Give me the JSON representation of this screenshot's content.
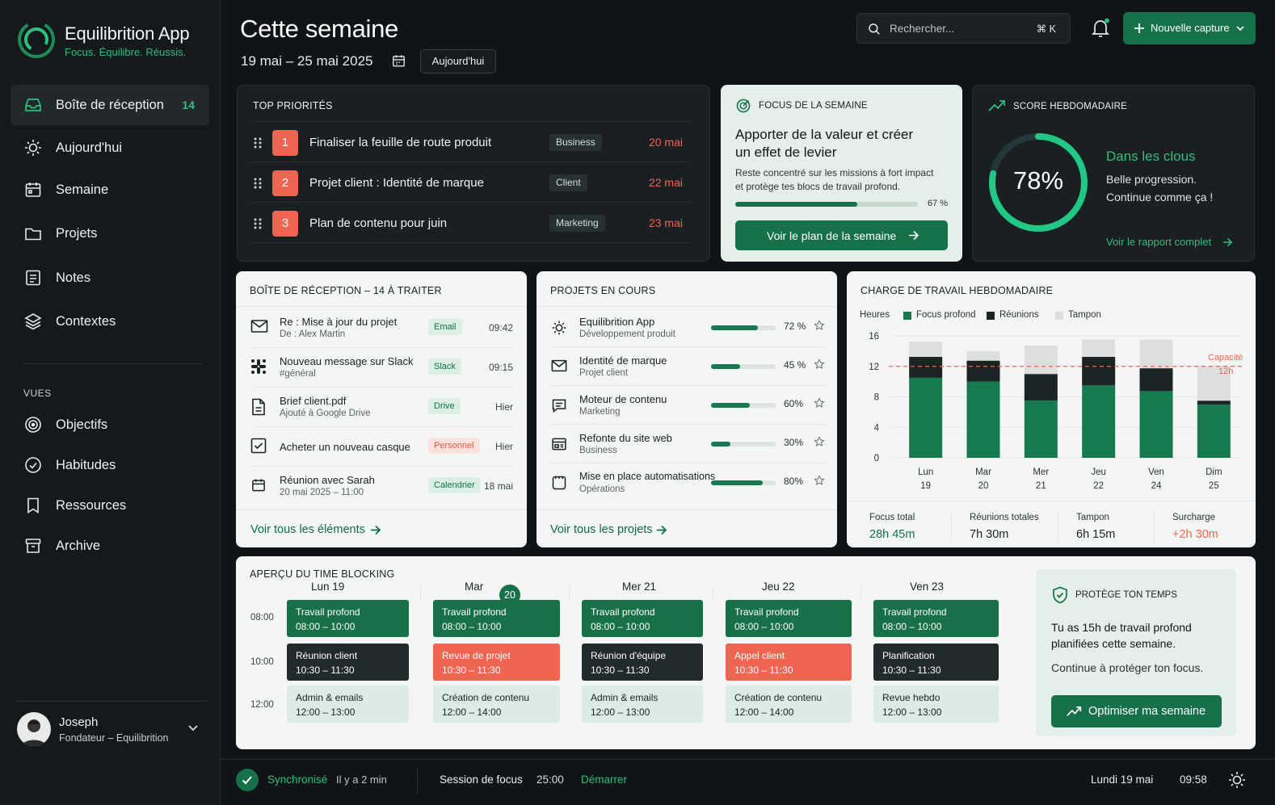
{
  "app": {
    "name": "Equilibrition App",
    "tagline": "Focus. Équilibre. Réussis."
  },
  "sidebar": {
    "items": [
      {
        "label": "Boîte de réception",
        "count": "14",
        "icon": "inbox-icon",
        "active": true
      },
      {
        "label": "Aujourd'hui",
        "icon": "sun-icon"
      },
      {
        "label": "Semaine",
        "icon": "calendar-icon"
      },
      {
        "label": "Projets",
        "icon": "folder-icon"
      },
      {
        "label": "Notes",
        "icon": "note-icon"
      },
      {
        "label": "Contextes",
        "icon": "layers-icon"
      }
    ],
    "views_title": "VUES",
    "views": [
      {
        "label": "Objectifs",
        "icon": "target-icon"
      },
      {
        "label": "Habitudes",
        "icon": "check-circle-icon"
      },
      {
        "label": "Ressources",
        "icon": "bookmark-icon"
      },
      {
        "label": "Archive",
        "icon": "archive-icon"
      }
    ],
    "user": {
      "name": "Joseph",
      "role": "Fondateur – Equilibrition"
    }
  },
  "header": {
    "title": "Cette semaine",
    "range": "19 mai – 25 mai 2025",
    "today_label": "Aujourd'hui",
    "search_placeholder": "Rechercher...",
    "search_shortcut": "⌘ K",
    "new_label": "Nouvelle capture"
  },
  "priorities": {
    "title": "TOP PRIORITÉS",
    "items": [
      {
        "num": "1",
        "text": "Finaliser la feuille de route produit",
        "tag": "Business",
        "date": "20 mai"
      },
      {
        "num": "2",
        "text": "Projet client : Identité de marque",
        "tag": "Client",
        "date": "22 mai"
      },
      {
        "num": "3",
        "text": "Plan de contenu pour juin",
        "tag": "Marketing",
        "date": "23 mai"
      }
    ]
  },
  "focus": {
    "title": "FOCUS DE LA SEMAINE",
    "heading_line1": "Apporter de la valeur et créer",
    "heading_line2": "un effet de levier",
    "desc_line1": "Reste concentré sur les missions à fort impact",
    "desc_line2": "et protège tes blocs de travail profond.",
    "progress": 67,
    "progress_label": "67 %",
    "button": "Voir le plan de la semaine"
  },
  "score": {
    "title": "SCORE HEBDOMADAIRE",
    "value": 78,
    "value_label": "78%",
    "headline": "Dans les clous",
    "line1": "Belle progression.",
    "line2": "Continue comme ça !",
    "link": "Voir le rapport complet"
  },
  "inbox": {
    "title": "BOÎTE DE RÉCEPTION – 14 À TRAITER",
    "items": [
      {
        "title": "Re : Mise à jour du projet",
        "sub": "De : Alex Martin",
        "tag": "Email",
        "time": "09:42",
        "icon": "mail-icon",
        "tagColor": "green"
      },
      {
        "title": "Nouveau message sur Slack",
        "sub": "#général",
        "tag": "Slack",
        "time": "09:15",
        "icon": "slack-icon",
        "tagColor": "green"
      },
      {
        "title": "Brief client.pdf",
        "sub": "Ajouté à Google Drive",
        "tag": "Drive",
        "time": "Hier",
        "icon": "file-icon",
        "tagColor": "green"
      },
      {
        "title": "Acheter un nouveau casque",
        "sub": "",
        "tag": "Personnel",
        "time": "Hier",
        "icon": "checkbox-icon",
        "tagColor": "red"
      },
      {
        "title": "Réunion avec Sarah",
        "sub": "20 mai 2025 – 11:00",
        "tag": "Calendrier",
        "time": "18 mai",
        "icon": "calendar-icon",
        "tagColor": "green"
      }
    ],
    "link": "Voir tous les éléments"
  },
  "projects": {
    "title": "PROJETS EN COURS",
    "items": [
      {
        "name": "Equilibrition App",
        "sub": "Développement produit",
        "progress": 72,
        "label": "72 %",
        "icon": "sun-icon"
      },
      {
        "name": "Identité de marque",
        "sub": "Projet client",
        "progress": 45,
        "label": "45 %",
        "icon": "mail-icon"
      },
      {
        "name": "Moteur de contenu",
        "sub": "Marketing",
        "progress": 60,
        "label": "60%",
        "icon": "message-icon"
      },
      {
        "name": "Refonte du site web",
        "sub": "Business",
        "progress": 30,
        "label": "30%",
        "icon": "browser-icon"
      },
      {
        "name": "Mise en place automatisations",
        "sub": "Opérations",
        "progress": 80,
        "label": "80%",
        "icon": "box-icon"
      }
    ],
    "link": "Voir tous les projets"
  },
  "workload": {
    "title": "CHARGE DE TRAVAIL HEBDOMADAIRE",
    "legend_hours": "Heures",
    "capacity_label1": "Capacité",
    "capacity_label2": "12h",
    "stats": [
      {
        "label": "Focus total",
        "value": "28h 45m",
        "color": "#2fbf7f"
      },
      {
        "label": "Réunions totales",
        "value": "7h 30m",
        "color": "#e9ecec"
      },
      {
        "label": "Tampon",
        "value": "6h 15m",
        "color": "#e9ecec"
      },
      {
        "label": "Surcharge",
        "value": "+2h 30m",
        "color": "#f06552"
      }
    ]
  },
  "chart_data": {
    "type": "bar",
    "stacked": true,
    "title": "CHARGE DE TRAVAIL HEBDOMADAIRE",
    "ylabel": "Heures",
    "ylim": [
      0,
      16
    ],
    "yticks": [
      0,
      4,
      8,
      12,
      16
    ],
    "categories": [
      "Lun 19",
      "Mar 20",
      "Mer 21",
      "Jeu 22",
      "Ven 24",
      "Dim 25"
    ],
    "category_top": [
      "Lun",
      "Mar",
      "Mer",
      "Jeu",
      "Ven",
      "Dim"
    ],
    "category_bottom": [
      "19",
      "20",
      "21",
      "22",
      "24",
      "25"
    ],
    "series": [
      {
        "name": "Focus profond",
        "color": "#157a4d",
        "values": [
          10.5,
          10.0,
          7.5,
          9.5,
          8.75,
          7.0
        ]
      },
      {
        "name": "Réunions",
        "color": "#1c2324",
        "values": [
          2.75,
          2.75,
          3.5,
          3.75,
          3.0,
          0.5
        ]
      },
      {
        "name": "Tampon",
        "color": "#dcdfde",
        "values": [
          2.0,
          1.25,
          3.75,
          2.25,
          3.75,
          4.5
        ]
      }
    ],
    "capacity": 12,
    "grid": true,
    "legend": "top"
  },
  "timeblock": {
    "title": "APERÇU DU TIME BLOCKING",
    "times": [
      "08:00",
      "10:00",
      "12:00"
    ],
    "days": [
      {
        "name": "Lun 19",
        "badge": "",
        "blocks": [
          {
            "t": "Travail profond",
            "h": "08:00 – 10:00",
            "k": "g"
          },
          {
            "t": "Réunion client",
            "h": "10:30 – 11:30",
            "k": "d"
          },
          {
            "t": "Admin & emails",
            "h": "12:00 – 13:00",
            "k": "l"
          }
        ]
      },
      {
        "name": "Mar",
        "badge": "20",
        "blocks": [
          {
            "t": "Travail profond",
            "h": "08:00 – 10:00",
            "k": "g"
          },
          {
            "t": "Revue de projet",
            "h": "10:30 – 11:30",
            "k": "r"
          },
          {
            "t": "Création de contenu",
            "h": "12:00 – 14:00",
            "k": "l"
          }
        ]
      },
      {
        "name": "Mer 21",
        "badge": "",
        "blocks": [
          {
            "t": "Travail profond",
            "h": "08:00 – 10:00",
            "k": "g"
          },
          {
            "t": "Réunion d'équipe",
            "h": "10:30 – 11:30",
            "k": "d"
          },
          {
            "t": "Admin & emails",
            "h": "12:00 – 13:00",
            "k": "l"
          }
        ]
      },
      {
        "name": "Jeu 22",
        "badge": "",
        "blocks": [
          {
            "t": "Travail profond",
            "h": "08:00 – 10:00",
            "k": "g"
          },
          {
            "t": "Appel client",
            "h": "10:30 – 11:30",
            "k": "r"
          },
          {
            "t": "Création de contenu",
            "h": "12:00 – 14:00",
            "k": "l"
          }
        ]
      },
      {
        "name": "Ven 23",
        "badge": "",
        "blocks": [
          {
            "t": "Travail profond",
            "h": "08:00 – 10:00",
            "k": "g"
          },
          {
            "t": "Planification",
            "h": "10:30 – 11:30",
            "k": "d"
          },
          {
            "t": "Revue hebdo",
            "h": "12:00 – 13:00",
            "k": "l"
          }
        ]
      }
    ],
    "protect": {
      "title": "PROTÈGE TON TEMPS",
      "line1": "Tu as 15h de travail profond",
      "line2": "planifiées cette semaine.",
      "line3": "Continue à protéger ton focus.",
      "button": "Optimiser ma semaine"
    }
  },
  "footer": {
    "sync": "Synchronisé",
    "sync_time": "Il y a 2 min",
    "session_label": "Session de focus",
    "session_time": "25:00",
    "start": "Démarrer",
    "date": "Lundi 19 mai",
    "clock": "09:58"
  },
  "colors": {
    "accent": "#2fbf7f",
    "accent_dark": "#16704a",
    "danger": "#f06552",
    "bg": "#111416"
  }
}
